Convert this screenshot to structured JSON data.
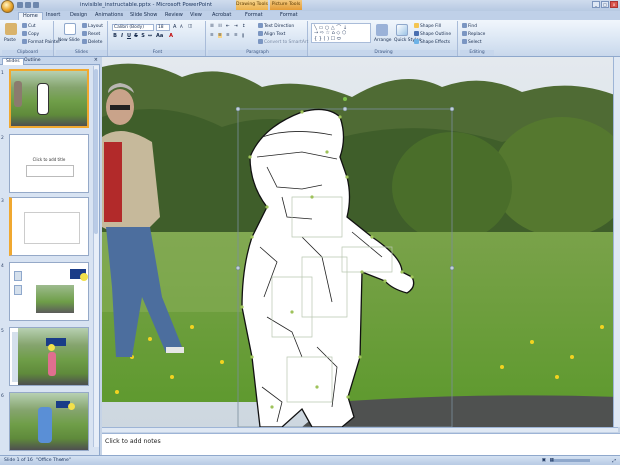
{
  "window": {
    "title": "invisible_instructable.pptx - Microsoft PowerPoint",
    "contextual_tabs": [
      "Drawing Tools",
      "Picture Tools"
    ]
  },
  "tabs": [
    "Home",
    "Insert",
    "Design",
    "Animations",
    "Slide Show",
    "Review",
    "View",
    "Acrobat",
    "Format",
    "Format"
  ],
  "ribbon": {
    "clipboard": {
      "label": "Clipboard",
      "paste": "Paste",
      "cut": "Cut",
      "copy": "Copy",
      "format_painter": "Format Painter"
    },
    "slides": {
      "label": "Slides",
      "new_slide": "New Slide",
      "layout": "Layout",
      "reset": "Reset",
      "delete": "Delete"
    },
    "font": {
      "label": "Font",
      "font_name": "Calibri (Body)",
      "font_size": "18"
    },
    "paragraph": {
      "label": "Paragraph",
      "text_direction": "Text Direction",
      "align_text": "Align Text",
      "convert_smartart": "Convert to SmartArt"
    },
    "drawing": {
      "label": "Drawing",
      "arrange": "Arrange",
      "quick_styles": "Quick Styles",
      "shape_fill": "Shape Fill",
      "shape_outline": "Shape Outline",
      "shape_effects": "Shape Effects"
    },
    "editing": {
      "label": "Editing",
      "find": "Find",
      "replace": "Replace",
      "select": "Select"
    }
  },
  "sidebar": {
    "tabs": [
      "Slides",
      "Outline"
    ],
    "slides": [
      {
        "num": "1",
        "text": ""
      },
      {
        "num": "2",
        "text": "Click to add title"
      },
      {
        "num": "3",
        "text": ""
      },
      {
        "num": "4",
        "text": ""
      },
      {
        "num": "5",
        "text": ""
      },
      {
        "num": "6",
        "text": ""
      }
    ]
  },
  "notes": {
    "placeholder": "Click to add notes"
  },
  "status": {
    "slide_of": "Slide 1 of 16",
    "theme": "\"Office Theme\""
  },
  "colors": {
    "accent": "#f0a830",
    "ribbon_bg": "#dbe6f4",
    "selection_outline": "#1b1b1b"
  }
}
